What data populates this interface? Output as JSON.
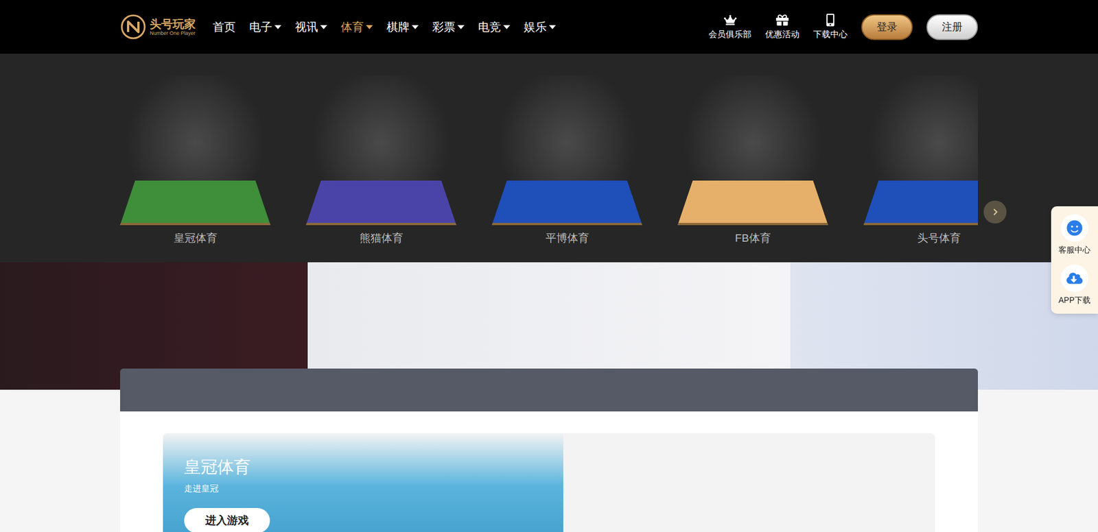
{
  "logo": {
    "title": "头号玩家",
    "subtitle": "Number One Player"
  },
  "nav": [
    {
      "label": "首页",
      "has_menu": false,
      "selected": false
    },
    {
      "label": "电子",
      "has_menu": true,
      "selected": false
    },
    {
      "label": "视讯",
      "has_menu": true,
      "selected": false
    },
    {
      "label": "体育",
      "has_menu": true,
      "selected": true
    },
    {
      "label": "棋牌",
      "has_menu": true,
      "selected": false
    },
    {
      "label": "彩票",
      "has_menu": true,
      "selected": false
    },
    {
      "label": "电竞",
      "has_menu": true,
      "selected": false
    },
    {
      "label": "娱乐",
      "has_menu": true,
      "selected": false
    }
  ],
  "quick_links": [
    {
      "label": "会员俱乐部",
      "kind": "club"
    },
    {
      "label": "优惠活动",
      "kind": "promo"
    },
    {
      "label": "下载中心",
      "kind": "download"
    }
  ],
  "auth": {
    "login": "登录",
    "register": "注册"
  },
  "sports_menu": {
    "items": [
      {
        "label": "皇冠体育",
        "color": "#3e8e3a"
      },
      {
        "label": "熊猫体育",
        "color": "#4b44a8"
      },
      {
        "label": "平博体育",
        "color": "#1f4fb8"
      },
      {
        "label": "FB体育",
        "color": "#e6b06a"
      },
      {
        "label": "头号体育",
        "color": "#1f4fb8"
      }
    ]
  },
  "side_widget": [
    {
      "label": "客服中心",
      "kind": "service"
    },
    {
      "label": "APP下载",
      "kind": "app"
    }
  ],
  "section": {
    "title": "皇冠体育",
    "subtitle": "走进皇冠",
    "button": "进入游戏"
  }
}
